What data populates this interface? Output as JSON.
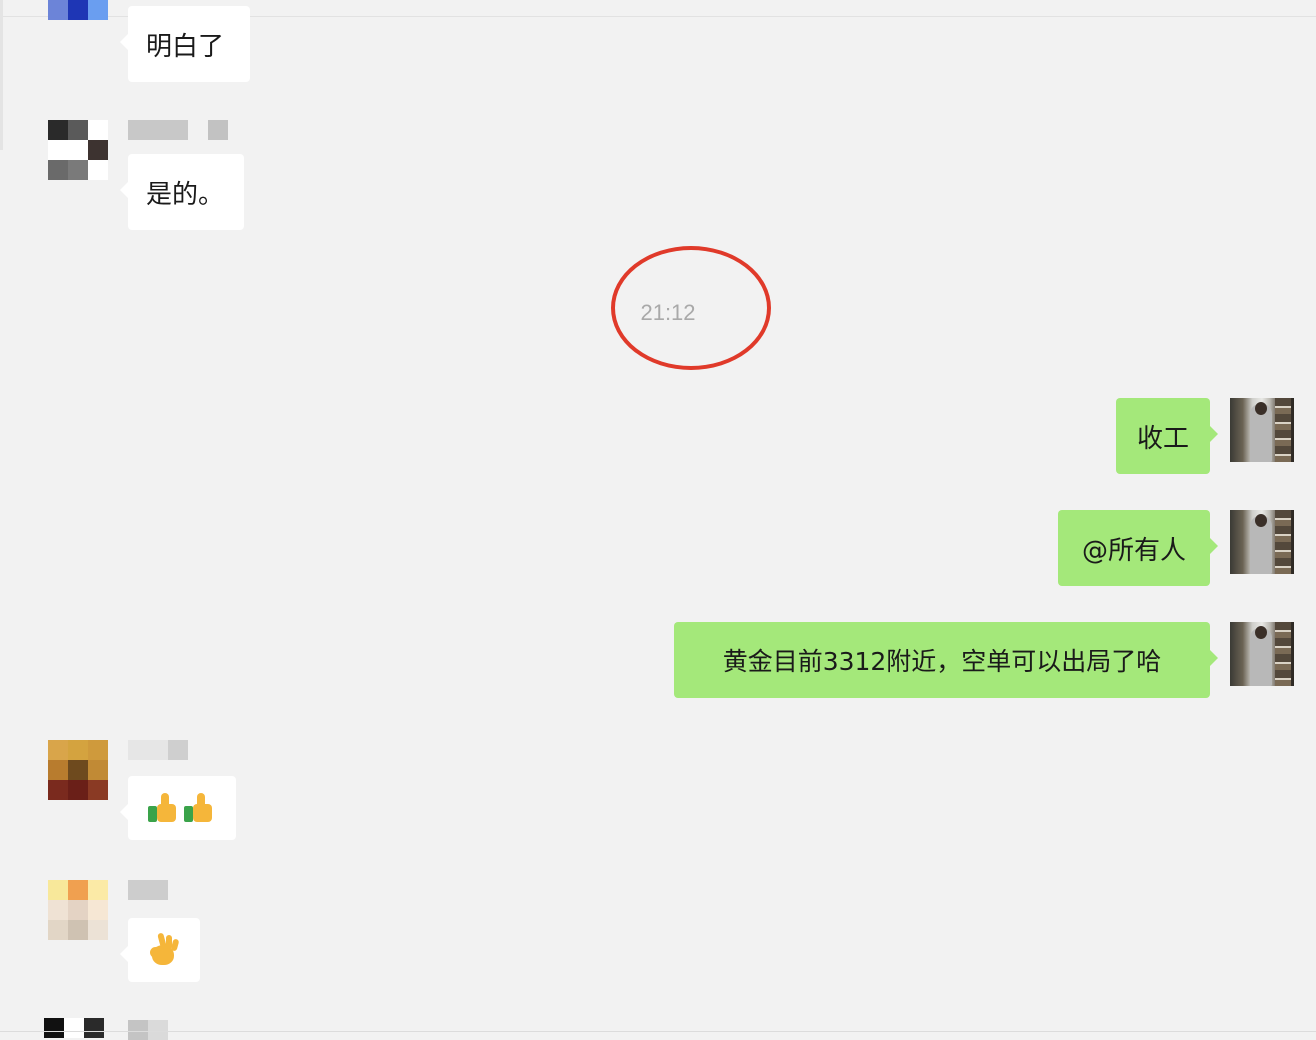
{
  "chat": {
    "timestamp": "21:12",
    "messages": [
      {
        "direction": "in",
        "text": "明白了"
      },
      {
        "direction": "in",
        "text": "是的。"
      },
      {
        "direction": "out",
        "text": "收工"
      },
      {
        "direction": "out",
        "text": "@所有人"
      },
      {
        "direction": "out",
        "text": "黄金目前3312附近，空单可以出局了哈"
      },
      {
        "direction": "in",
        "emoji": [
          "thumbs-up",
          "thumbs-up"
        ]
      },
      {
        "direction": "in",
        "emoji": [
          "ok-hand"
        ]
      }
    ]
  },
  "colors": {
    "background": "#f2f2f2",
    "incoming_bubble": "#ffffff",
    "outgoing_bubble": "#a4e87a",
    "timestamp_text": "#a9a9a9",
    "highlight_circle": "#e03a2a"
  },
  "icons": {
    "thumbs_up": "thumbs-up-icon",
    "ok_hand": "ok-hand-icon"
  }
}
